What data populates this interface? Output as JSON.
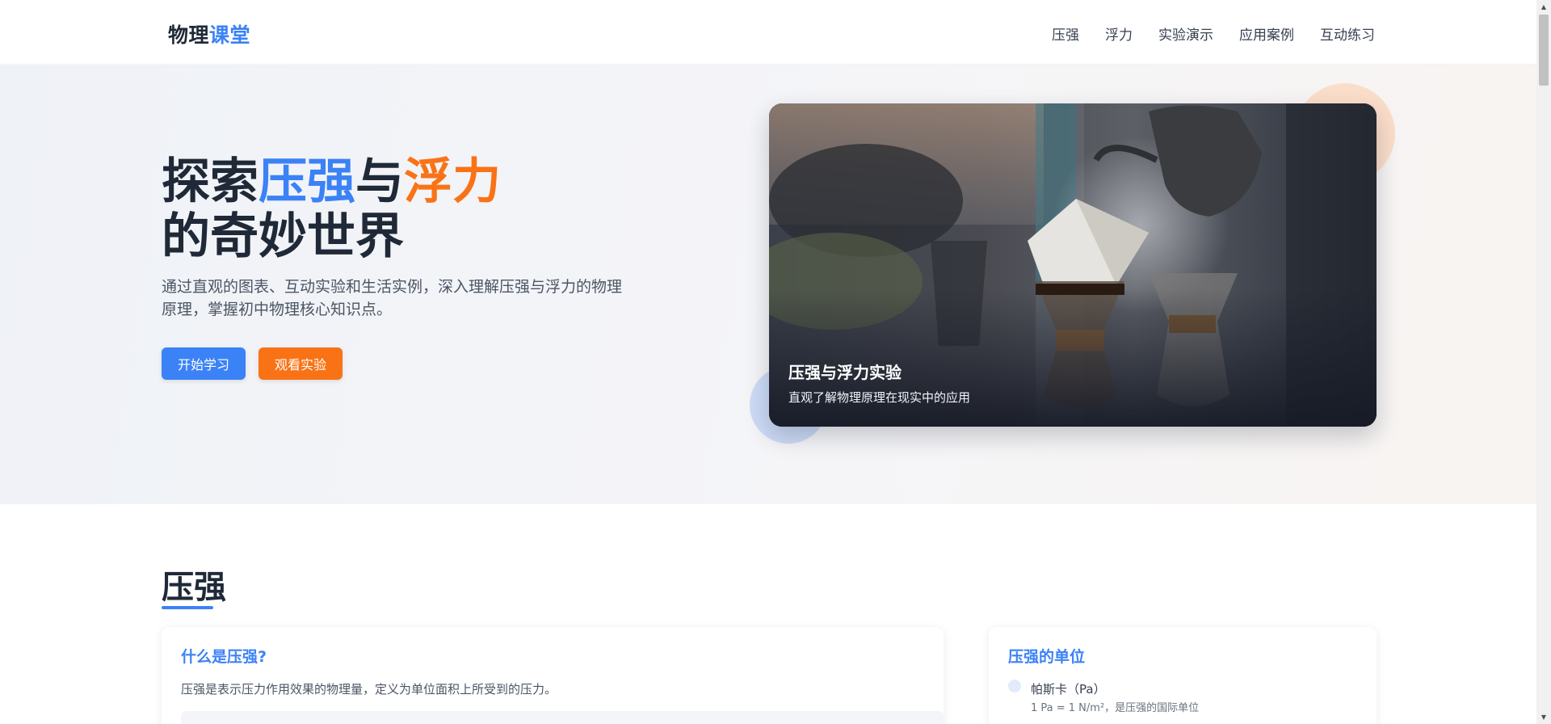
{
  "header": {
    "logo_main": "物理",
    "logo_accent": "课堂",
    "nav": [
      "压强",
      "浮力",
      "实验演示",
      "应用案例",
      "互动练习"
    ]
  },
  "hero": {
    "title_part1": "探索",
    "title_blue": "压强",
    "title_part2": "与",
    "title_orange": "浮力",
    "title_line2": "的奇妙世界",
    "description": "通过直观的图表、互动实验和生活实例，深入理解压强与浮力的物理原理，掌握初中物理核心知识点。",
    "primary_button": "开始学习",
    "secondary_button": "观看实验",
    "image_card": {
      "title": "压强与浮力实验",
      "subtitle": "直观了解物理原理在现实中的应用"
    }
  },
  "section": {
    "title": "压强",
    "definition_card": {
      "heading": "什么是压强?",
      "text": "压强是表示压力作用效果的物理量，定义为单位面积上所受到的压力。"
    },
    "units_card": {
      "heading": "压强的单位",
      "unit_name": "帕斯卡（Pa）",
      "unit_desc": "1 Pa = 1 N/m²，是压强的国际单位"
    }
  },
  "colors": {
    "primary": "#3b82f6",
    "secondary": "#f97316",
    "text": "#1f2937"
  }
}
